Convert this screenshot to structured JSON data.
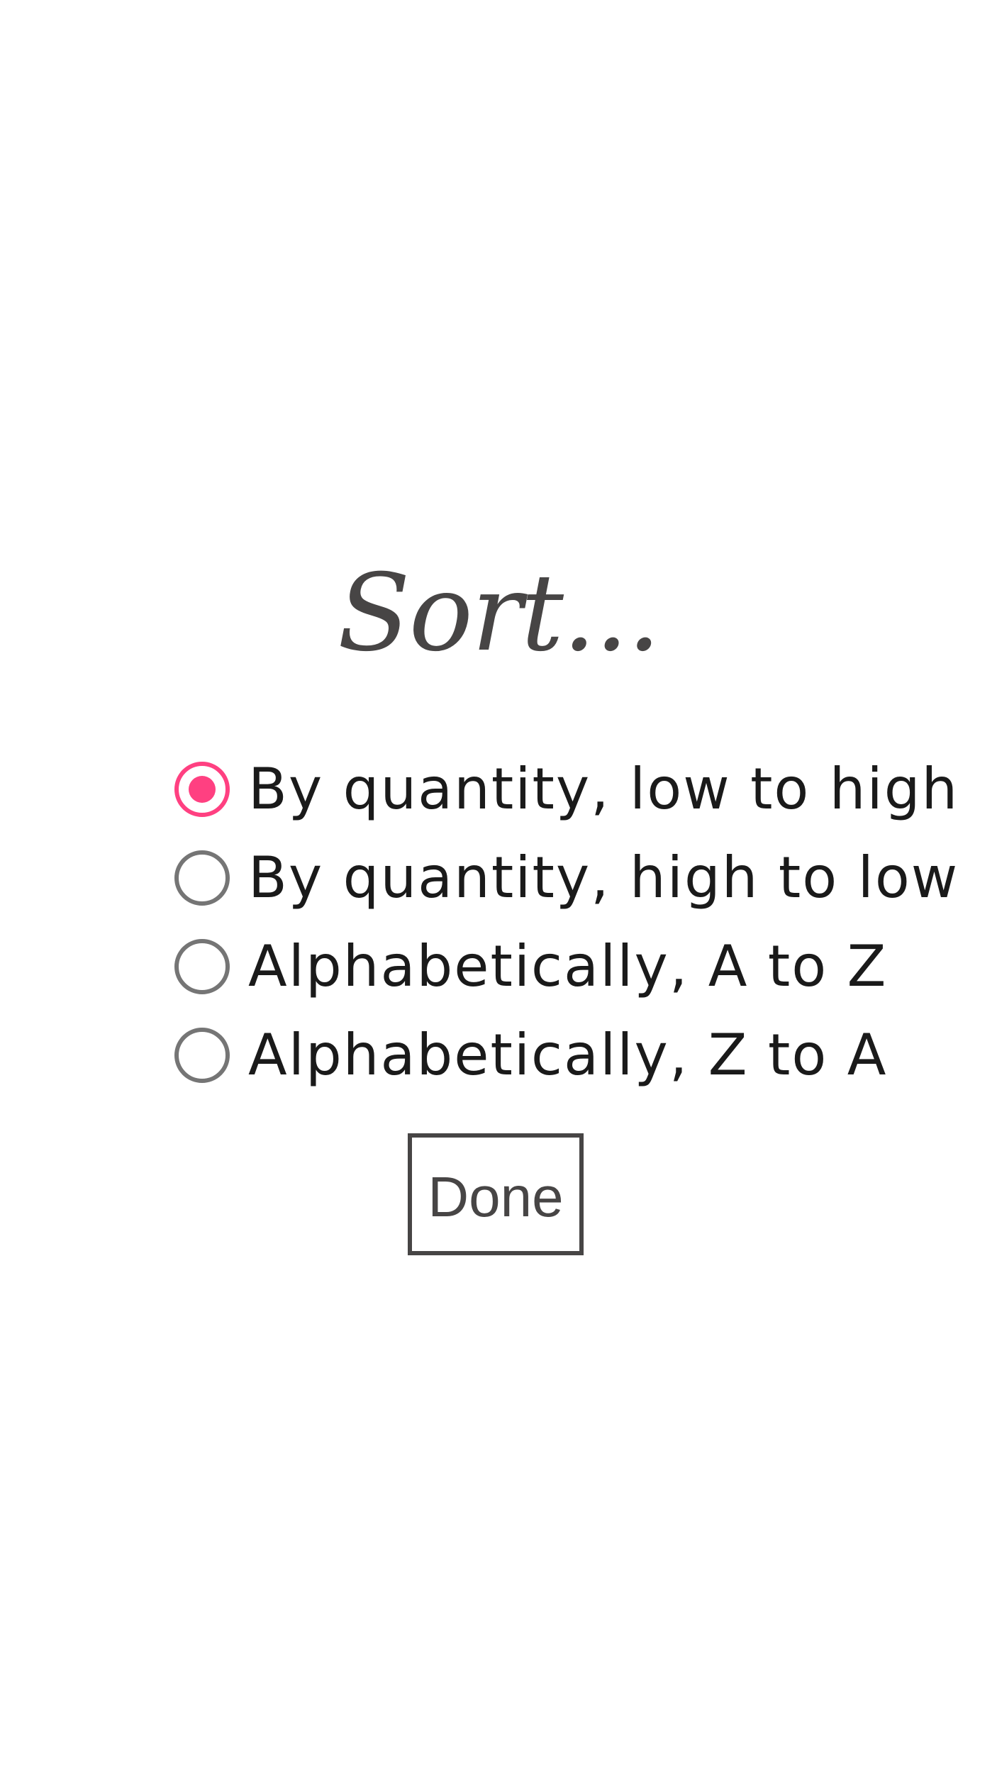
{
  "dialog": {
    "title": "Sort...",
    "options": [
      {
        "label": "By quantity, low to high",
        "selected": true
      },
      {
        "label": "By quantity, high to low",
        "selected": false
      },
      {
        "label": "Alphabetically, A to Z",
        "selected": false
      },
      {
        "label": "Alphabetically, Z to A",
        "selected": false
      }
    ],
    "done_label": "Done"
  },
  "colors": {
    "accent": "#ff4081",
    "radio_unchecked": "#757575",
    "title_text": "#474545",
    "option_text": "#1a1a1a"
  }
}
